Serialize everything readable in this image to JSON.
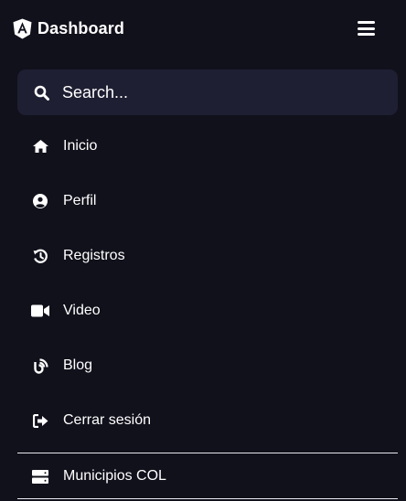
{
  "header": {
    "title": "Dashboard",
    "logo_icon": "angular-logo-icon",
    "menu_icon": "hamburger-menu-icon"
  },
  "search": {
    "placeholder": "Search...",
    "icon": "search-icon"
  },
  "nav": {
    "items": [
      {
        "label": "Inicio",
        "icon": "home-icon"
      },
      {
        "label": "Perfil",
        "icon": "user-circle-icon"
      },
      {
        "label": "Registros",
        "icon": "history-icon"
      },
      {
        "label": "Video",
        "icon": "video-camera-icon"
      },
      {
        "label": "Blog",
        "icon": "blog-icon"
      },
      {
        "label": "Cerrar sesión",
        "icon": "sign-out-icon"
      }
    ]
  },
  "extra": {
    "items": [
      {
        "label": "Municipios COL",
        "icon": "server-icon"
      }
    ]
  },
  "colors": {
    "background": "#11111c",
    "search_background": "#1f1f33",
    "text": "#ffffff",
    "divider": "#e8e8ee"
  }
}
